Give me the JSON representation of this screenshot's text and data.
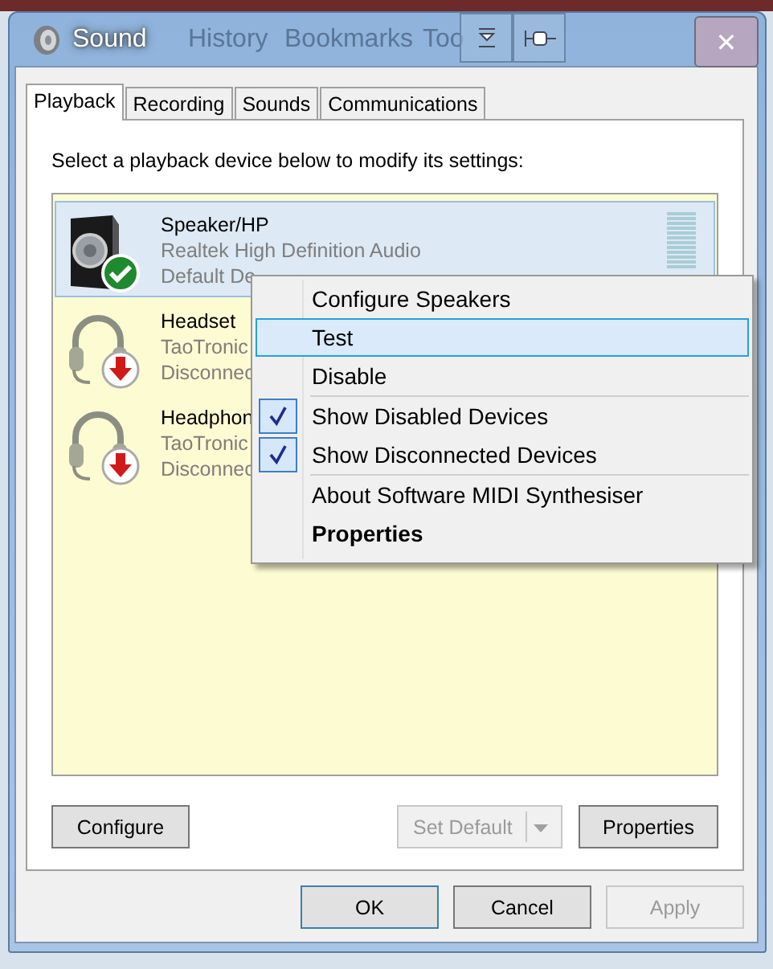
{
  "window": {
    "title": "Sound",
    "close": "✕"
  },
  "background_menu": [
    {
      "label": "History"
    },
    {
      "label": "Bookmarks"
    },
    {
      "label": "Too"
    }
  ],
  "tabs": [
    {
      "label": "Playback",
      "selected": true
    },
    {
      "label": "Recording",
      "selected": false
    },
    {
      "label": "Sounds",
      "selected": false
    },
    {
      "label": "Communications",
      "selected": false
    }
  ],
  "instruction": "Select a playback device below to modify its settings:",
  "devices": [
    {
      "kind": "speaker",
      "name": "Speaker/HP",
      "driver": "Realtek High Definition Audio",
      "status": "Default De",
      "selected": true
    },
    {
      "kind": "headset",
      "name": "Headset",
      "driver": "TaoTronic",
      "status": "Disconnec",
      "selected": false
    },
    {
      "kind": "headset",
      "name": "Headphon",
      "driver": "TaoTronic",
      "status": "Disconnec",
      "selected": false
    }
  ],
  "context_menu": [
    {
      "kind": "item",
      "label": "Configure Speakers",
      "highlighted": false,
      "checked": false,
      "bold": false
    },
    {
      "kind": "item",
      "label": "Test",
      "highlighted": true,
      "checked": false,
      "bold": false
    },
    {
      "kind": "item",
      "label": "Disable",
      "highlighted": false,
      "checked": false,
      "bold": false
    },
    {
      "kind": "separator"
    },
    {
      "kind": "item",
      "label": "Show Disabled Devices",
      "highlighted": false,
      "checked": true,
      "bold": false
    },
    {
      "kind": "item",
      "label": "Show Disconnected Devices",
      "highlighted": false,
      "checked": true,
      "bold": false
    },
    {
      "kind": "separator"
    },
    {
      "kind": "item",
      "label": "About Software MIDI Synthesiser",
      "highlighted": false,
      "checked": false,
      "bold": false
    },
    {
      "kind": "item",
      "label": "Properties",
      "highlighted": false,
      "checked": false,
      "bold": true
    }
  ],
  "panel_buttons": [
    {
      "kind": "button",
      "label": "Configure",
      "disabled": false
    },
    {
      "kind": "spacer"
    },
    {
      "kind": "split",
      "label": "Set Default",
      "disabled": true
    },
    {
      "kind": "button",
      "label": "Properties",
      "disabled": false
    }
  ],
  "dialog_buttons": [
    {
      "label": "OK",
      "default": true,
      "disabled": false
    },
    {
      "label": "Cancel",
      "default": false,
      "disabled": false
    },
    {
      "label": "Apply",
      "default": false,
      "disabled": true
    }
  ]
}
